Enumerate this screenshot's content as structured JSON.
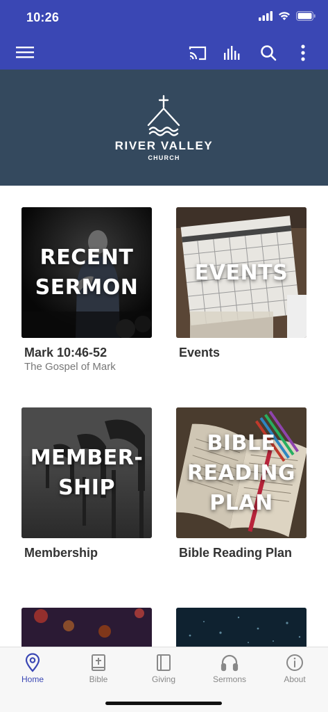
{
  "status": {
    "time": "10:26"
  },
  "colors": {
    "accent": "#3a47b4",
    "brand_bg": "#34495e",
    "tab_inactive": "#888888"
  },
  "header": {
    "icons": [
      "menu-icon",
      "cast-icon",
      "audio-bars-icon",
      "search-icon",
      "more-vertical-icon"
    ]
  },
  "brand": {
    "name": "RIVER VALLEY",
    "subtitle": "CHURCH"
  },
  "tiles": [
    {
      "overlay": "RECENT\nSERMON",
      "title": "Mark 10:46-52",
      "subtitle": "The Gospel of Mark"
    },
    {
      "overlay": "EVENTS",
      "title": "Events",
      "subtitle": ""
    },
    {
      "overlay": "MEMBER-\nSHIP",
      "title": "Membership",
      "subtitle": ""
    },
    {
      "overlay": "BIBLE\nREADING\nPLAN",
      "title": "Bible Reading Plan",
      "subtitle": ""
    }
  ],
  "tabs": [
    {
      "label": "Home",
      "icon": "location-pin-icon",
      "active": true
    },
    {
      "label": "Bible",
      "icon": "bible-icon",
      "active": false
    },
    {
      "label": "Giving",
      "icon": "book-icon",
      "active": false
    },
    {
      "label": "Sermons",
      "icon": "headphones-icon",
      "active": false
    },
    {
      "label": "About",
      "icon": "info-icon",
      "active": false
    }
  ]
}
